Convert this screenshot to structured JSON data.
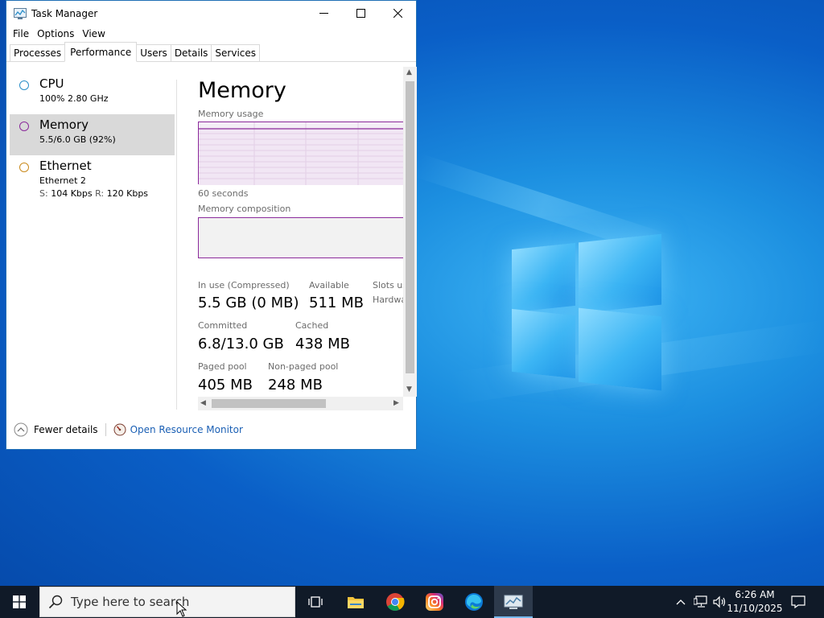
{
  "window": {
    "title": "Task Manager",
    "menu": [
      "File",
      "Options",
      "View"
    ],
    "tabs": [
      "Processes",
      "Performance",
      "Users",
      "Details",
      "Services"
    ],
    "active_tab": "Performance"
  },
  "resources": [
    {
      "name": "CPU",
      "sub": "100%  2.80 GHz",
      "color": "#2a8ec8"
    },
    {
      "name": "Memory",
      "sub": "5.5/6.0 GB (92%)",
      "color": "#8b2a9b",
      "selected": true
    },
    {
      "name": "Ethernet",
      "sub": "Ethernet 2",
      "sub2_s_label": "S:",
      "sub2_s_value": "104 Kbps",
      "sub2_r_label": "R:",
      "sub2_r_value": "120 Kbps",
      "color": "#c98a1d"
    }
  ],
  "memory": {
    "title": "Memory",
    "usage_label": "Memory usage",
    "time_label": "60 seconds",
    "composition_label": "Memory composition",
    "stats": {
      "in_use_label": "In use (Compressed)",
      "in_use_value": "5.5 GB (0 MB)",
      "available_label": "Available",
      "available_value": "511 MB",
      "slots_label": "Slots us",
      "hardware_label": "Hardwa",
      "committed_label": "Committed",
      "committed_value": "6.8/13.0 GB",
      "cached_label": "Cached",
      "cached_value": "438 MB",
      "paged_label": "Paged pool",
      "paged_value": "405 MB",
      "nonpaged_label": "Non-paged pool",
      "nonpaged_value": "248 MB"
    }
  },
  "footer": {
    "fewer_details": "Fewer details",
    "open_monitor": "Open Resource Monitor"
  },
  "taskbar": {
    "search_placeholder": "Type here to search",
    "time": "6:26 AM",
    "date": "11/10/2025"
  }
}
